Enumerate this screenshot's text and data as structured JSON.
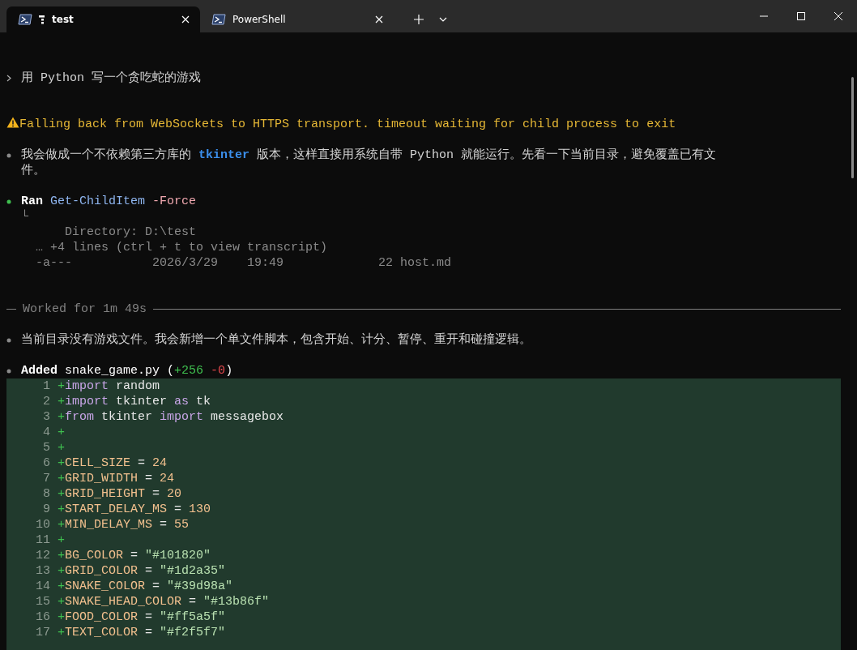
{
  "tabs": [
    {
      "title": "test",
      "selected": true,
      "activity": true
    },
    {
      "title": "PowerShell",
      "selected": false,
      "activity": false
    }
  ],
  "transcript": [
    {
      "kind": "prompt",
      "text": "用 Python 写一个贪吃蛇的游戏"
    },
    {
      "kind": "warning",
      "text": "Falling back from WebSockets to HTTPS transport. timeout waiting for child process to exit"
    },
    {
      "kind": "message",
      "text": "我会做成一个不依赖第三方库的 **tkinter** 版本，这样直接用系统自带 Python 就能运行。先看一下当前目录，避免覆盖已有文件。"
    },
    {
      "kind": "command",
      "verb": "Ran",
      "command": "Get-ChildItem",
      "args": "-Force",
      "output": [
        "└",
        "      Directory: D:\\test",
        "  … +4 lines (ctrl + t to view transcript)",
        "  -a---           2026/3/29    19:49             22 host.md"
      ]
    },
    {
      "kind": "separator",
      "text": "Worked for 1m 49s"
    },
    {
      "kind": "message",
      "text": "当前目录没有游戏文件。我会新增一个单文件脚本，包含开始、计分、暂停、重开和碰撞逻辑。"
    },
    {
      "kind": "diff",
      "verb": "Added",
      "file": "snake_game.py",
      "stats": [
        {
          "text": "(",
          "kind": "paren"
        },
        {
          "text": "+256",
          "kind": "add"
        },
        {
          "text": "-0",
          "kind": "del"
        },
        {
          "text": ")",
          "kind": "paren"
        }
      ],
      "lines": [
        {
          "number": "1",
          "sign": "+",
          "tokens": [
            {
              "text": "import",
              "kind": "kw"
            },
            {
              "text": " random",
              "kind": "id"
            }
          ]
        },
        {
          "number": "2",
          "sign": "+",
          "tokens": [
            {
              "text": "import",
              "kind": "kw"
            },
            {
              "text": " tkinter ",
              "kind": "id"
            },
            {
              "text": "as",
              "kind": "kw"
            },
            {
              "text": " tk",
              "kind": "id"
            }
          ]
        },
        {
          "number": "3",
          "sign": "+",
          "tokens": [
            {
              "text": "from",
              "kind": "kw"
            },
            {
              "text": " tkinter ",
              "kind": "id"
            },
            {
              "text": "import",
              "kind": "kw"
            },
            {
              "text": " messagebox",
              "kind": "id"
            }
          ]
        },
        {
          "number": "4",
          "sign": "+"
        },
        {
          "number": "5",
          "sign": "+"
        },
        {
          "number": "6",
          "sign": "+",
          "tokens": [
            {
              "text": "CELL_SIZE",
              "kind": "const"
            },
            {
              "text": " = ",
              "kind": "id"
            },
            {
              "text": "24",
              "kind": "num"
            }
          ]
        },
        {
          "number": "7",
          "sign": "+",
          "tokens": [
            {
              "text": "GRID_WIDTH",
              "kind": "const"
            },
            {
              "text": " = ",
              "kind": "id"
            },
            {
              "text": "24",
              "kind": "num"
            }
          ]
        },
        {
          "number": "8",
          "sign": "+",
          "tokens": [
            {
              "text": "GRID_HEIGHT",
              "kind": "const"
            },
            {
              "text": " = ",
              "kind": "id"
            },
            {
              "text": "20",
              "kind": "num"
            }
          ]
        },
        {
          "number": "9",
          "sign": "+",
          "tokens": [
            {
              "text": "START_DELAY_MS",
              "kind": "const"
            },
            {
              "text": " = ",
              "kind": "id"
            },
            {
              "text": "130",
              "kind": "num"
            }
          ]
        },
        {
          "number": "10",
          "sign": "+",
          "tokens": [
            {
              "text": "MIN_DELAY_MS",
              "kind": "const"
            },
            {
              "text": " = ",
              "kind": "id"
            },
            {
              "text": "55",
              "kind": "num"
            }
          ]
        },
        {
          "number": "11",
          "sign": "+"
        },
        {
          "number": "12",
          "sign": "+",
          "tokens": [
            {
              "text": "BG_COLOR",
              "kind": "const"
            },
            {
              "text": " = ",
              "kind": "id"
            },
            {
              "text": "\"#101820\"",
              "kind": "str"
            }
          ]
        },
        {
          "number": "13",
          "sign": "+",
          "tokens": [
            {
              "text": "GRID_COLOR",
              "kind": "const"
            },
            {
              "text": " = ",
              "kind": "id"
            },
            {
              "text": "\"#1d2a35\"",
              "kind": "str"
            }
          ]
        },
        {
          "number": "14",
          "sign": "+",
          "tokens": [
            {
              "text": "SNAKE_COLOR",
              "kind": "const"
            },
            {
              "text": " = ",
              "kind": "id"
            },
            {
              "text": "\"#39d98a\"",
              "kind": "str"
            }
          ]
        },
        {
          "number": "15",
          "sign": "+",
          "tokens": [
            {
              "text": "SNAKE_HEAD_COLOR",
              "kind": "const"
            },
            {
              "text": " = ",
              "kind": "id"
            },
            {
              "text": "\"#13b86f\"",
              "kind": "str"
            }
          ]
        },
        {
          "number": "16",
          "sign": "+",
          "tokens": [
            {
              "text": "FOOD_COLOR",
              "kind": "const"
            },
            {
              "text": " = ",
              "kind": "id"
            },
            {
              "text": "\"#ff5a5f\"",
              "kind": "str"
            }
          ]
        },
        {
          "number": "17",
          "sign": "+",
          "tokens": [
            {
              "text": "TEXT_COLOR",
              "kind": "const"
            },
            {
              "text": " = ",
              "kind": "id"
            },
            {
              "text": "\"#f2f5f7\"",
              "kind": "str"
            }
          ]
        }
      ]
    }
  ]
}
